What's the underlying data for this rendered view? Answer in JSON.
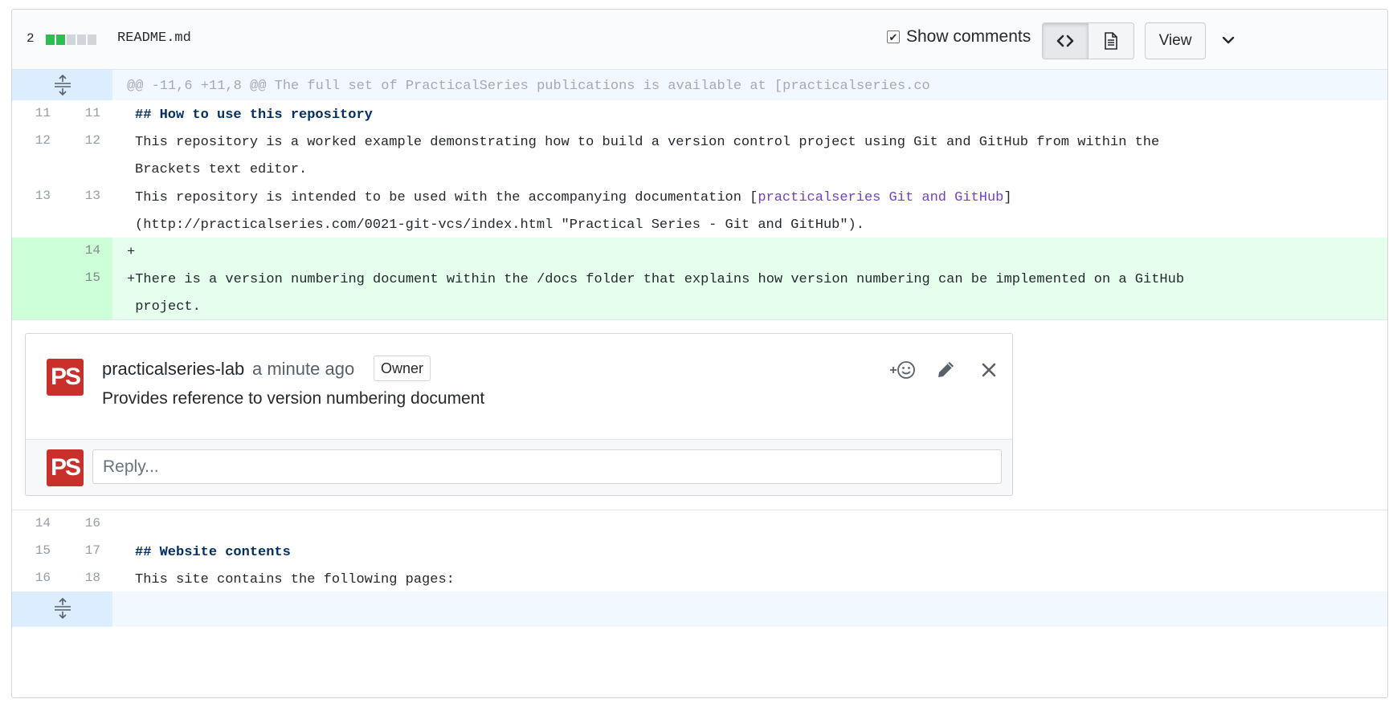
{
  "file": {
    "changes_count": "2",
    "diffstat_colors": [
      "#2cbe4e",
      "#2cbe4e",
      "#d1d5da",
      "#d1d5da",
      "#d1d5da"
    ],
    "name": "README.md"
  },
  "toolbar": {
    "show_comments_label": "Show comments",
    "show_comments_checked": true,
    "source_view_icon": "code-icon",
    "rich_view_icon": "file-icon",
    "view_label": "View",
    "more_icon": "chevron-down-icon"
  },
  "hunks": {
    "top_header": "@@ -11,6 +11,8 @@ The full set of PracticalSeries publications is available at [practicalseries.co",
    "expand_icon": "unfold-icon"
  },
  "lines_before": [
    {
      "old": "11",
      "new": "11",
      "text": "## How to use this repository"
    },
    {
      "old": "12",
      "new": "12",
      "text": "This repository is a worked example demonstrating how to build a version control project using Git and GitHub from within the",
      "text2": "Brackets text editor."
    },
    {
      "old": "13",
      "new": "13",
      "prefix": "This repository is intended to be used with the accompanying documentation [",
      "link": "practicalseries Git and GitHub",
      "suffix": "]",
      "text2": "(http://practicalseries.com/0021-git-vcs/index.html \"Practical Series - Git and GitHub\")."
    }
  ],
  "additions": [
    {
      "new": "14",
      "text": "+"
    },
    {
      "new": "15",
      "text": "+There is a version numbering document within the /docs folder that explains how version numbering can be implemented on a GitHub",
      "text2": " project."
    }
  ],
  "comment": {
    "avatar_text": "PS",
    "author": "practicalseries-lab",
    "time": "a minute ago",
    "badge": "Owner",
    "body": "Provides reference to version numbering document",
    "reaction_icon": "add-reaction-icon",
    "edit_icon": "pencil-icon",
    "delete_icon": "close-icon",
    "reply_placeholder": "Reply..."
  },
  "lines_after": [
    {
      "old": "14",
      "new": "16",
      "text": ""
    },
    {
      "old": "15",
      "new": "17",
      "text": "## Website contents"
    },
    {
      "old": "16",
      "new": "18",
      "text": "This site contains the following pages:"
    }
  ],
  "colors": {
    "addition_bg": "#e6ffed",
    "hunk_bg": "#f1f8ff",
    "avatar_red": "#c9302c",
    "heading": "#032f62",
    "link": "#6f42c1"
  }
}
